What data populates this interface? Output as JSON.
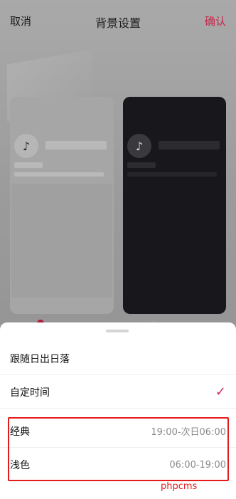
{
  "header": {
    "cancel_label": "取消",
    "title": "背景设置",
    "confirm_label": "确认"
  },
  "preview": {
    "light_logo_icon": "tiktok-logo-icon",
    "dark_logo_icon": "tiktok-logo-icon"
  },
  "sheet": {
    "options": [
      {
        "label": "跟随日出日落",
        "value": "",
        "selected": false
      },
      {
        "label": "自定时间",
        "value": "",
        "selected": true
      },
      {
        "label": "经典",
        "value": "19:00-次日06:00",
        "selected": false
      },
      {
        "label": "浅色",
        "value": "06:00-19:00",
        "selected": false
      }
    ],
    "check_icon": "checkmark-icon"
  },
  "watermark": "phpcms",
  "colors": {
    "accent": "#c8234a",
    "highlight": "#e31b1b"
  }
}
